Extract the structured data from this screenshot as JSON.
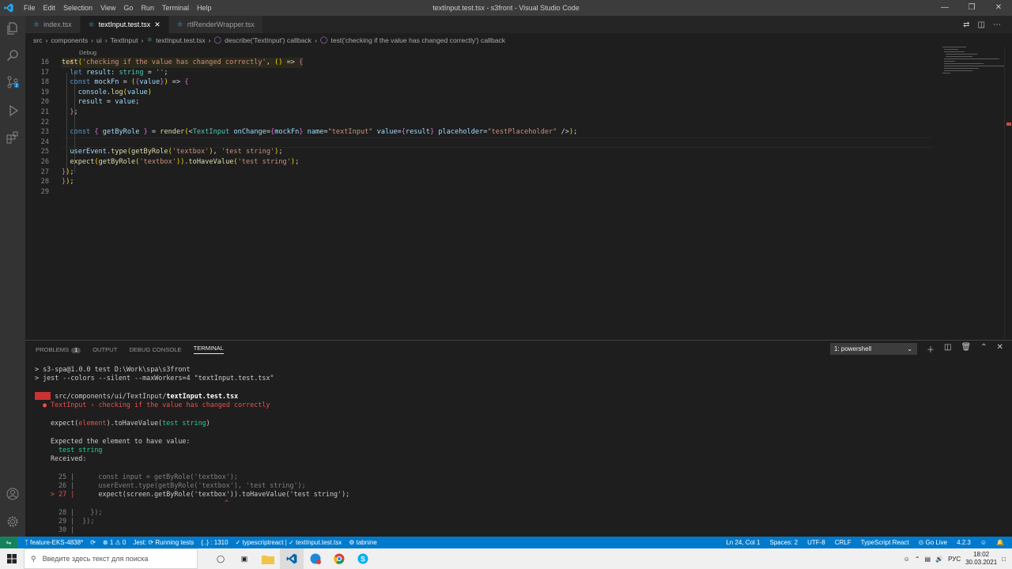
{
  "window": {
    "title": "textInput.test.tsx - s3front - Visual Studio Code",
    "menu": [
      "File",
      "Edit",
      "Selection",
      "View",
      "Go",
      "Run",
      "Terminal",
      "Help"
    ]
  },
  "tabs": [
    {
      "label": "index.tsx",
      "active": false
    },
    {
      "label": "textInput.test.tsx",
      "active": true,
      "close": "✕"
    },
    {
      "label": "rtlRenderWrapper.tsx",
      "active": false
    }
  ],
  "breadcrumb": [
    "src",
    "components",
    "ui",
    "TextInput",
    "textInput.test.tsx",
    "describe('TextInput') callback",
    "test('checking if the value has changed correctly') callback"
  ],
  "editor": {
    "codelens": "Debug",
    "lines": [
      {
        "n": "16",
        "t": "test('checking if the value has changed correctly', () => {"
      },
      {
        "n": "17",
        "t": "  let result: string = '';"
      },
      {
        "n": "18",
        "t": "  const mockFn = ({value}) => {"
      },
      {
        "n": "19",
        "t": "    console.log(value)"
      },
      {
        "n": "20",
        "t": "    result = value;"
      },
      {
        "n": "21",
        "t": "  };"
      },
      {
        "n": "22",
        "t": ""
      },
      {
        "n": "23",
        "t": "  const { getByRole } = render(<TextInput onChange={mockFn} name=\"textInput\" value={result} placeholder=\"testPlaceholder\" />);"
      },
      {
        "n": "24",
        "t": ""
      },
      {
        "n": "25",
        "t": "  userEvent.type(getByRole('textbox'), 'test string');"
      },
      {
        "n": "26",
        "t": "  expect(getByRole('textbox')).toHaveValue('test string');"
      },
      {
        "n": "27",
        "t": "});"
      },
      {
        "n": "28",
        "t": "});"
      },
      {
        "n": "29",
        "t": ""
      }
    ]
  },
  "panel": {
    "tabs": [
      "PROBLEMS",
      "OUTPUT",
      "DEBUG CONSOLE",
      "TERMINAL"
    ],
    "problems_count": "1",
    "terminal_select": "1: powershell",
    "lines": {
      "l1": "> s3-spa@1.0.0 test D:\\Work\\spa\\s3front",
      "l2": "> jest --colors --silent --maxWorkers=4 \"textInput.test.tsx\"",
      "fail_badge": "FAIL",
      "fail_path": "src/components/ui/TextInput/",
      "fail_file": "textInput.test.tsx",
      "fail_test": "● TextInput › checking if the value has changed correctly",
      "expect_a": "expect(",
      "expect_el": "element",
      "expect_b": ").toHaveValue(",
      "expect_c": "test string",
      "expect_d": ")",
      "expected_hdr": "Expected the element to have value:",
      "expected_val": "test string",
      "received_hdr": "Received:",
      "c25": "25 |      const input = getByRole('textbox');",
      "c26": "26 |      userEvent.type(getByRole('textbox'), 'test string');",
      "c27a": "> 27 |",
      "c27b": "      expect(screen.getByRole('textbox')).toHaveValue('test string');",
      "caret": "^",
      "c28": "28 |    });",
      "c29": "29 |  });",
      "c30": "30 |"
    }
  },
  "status": {
    "branch": "feature-EKS-4838*",
    "sync": "⟳",
    "errors": "⊗ 1 ⚠ 0",
    "jest": "Jest: ⟳ Running tests",
    "selection": "{..} : 1310",
    "ts": "✓ typescriptreact | ✓ textInput.test.tsx",
    "tabnine": "⚙ tabnine",
    "position": "Ln 24, Col 1",
    "spaces": "Spaces: 2",
    "encoding": "UTF-8",
    "eol": "CRLF",
    "lang": "TypeScript React",
    "golive": "⊙ Go Live",
    "version": "4.2.3"
  },
  "taskbar": {
    "search_placeholder": "Введите здесь текст для поиска",
    "lang": "РУС",
    "time": "18:02",
    "date": "30.03.2021"
  },
  "colors": {
    "statusbar": "#007acc",
    "titlebar": "#3c3c3c",
    "activity": "#333333",
    "fail_bg": "#cd3131"
  }
}
